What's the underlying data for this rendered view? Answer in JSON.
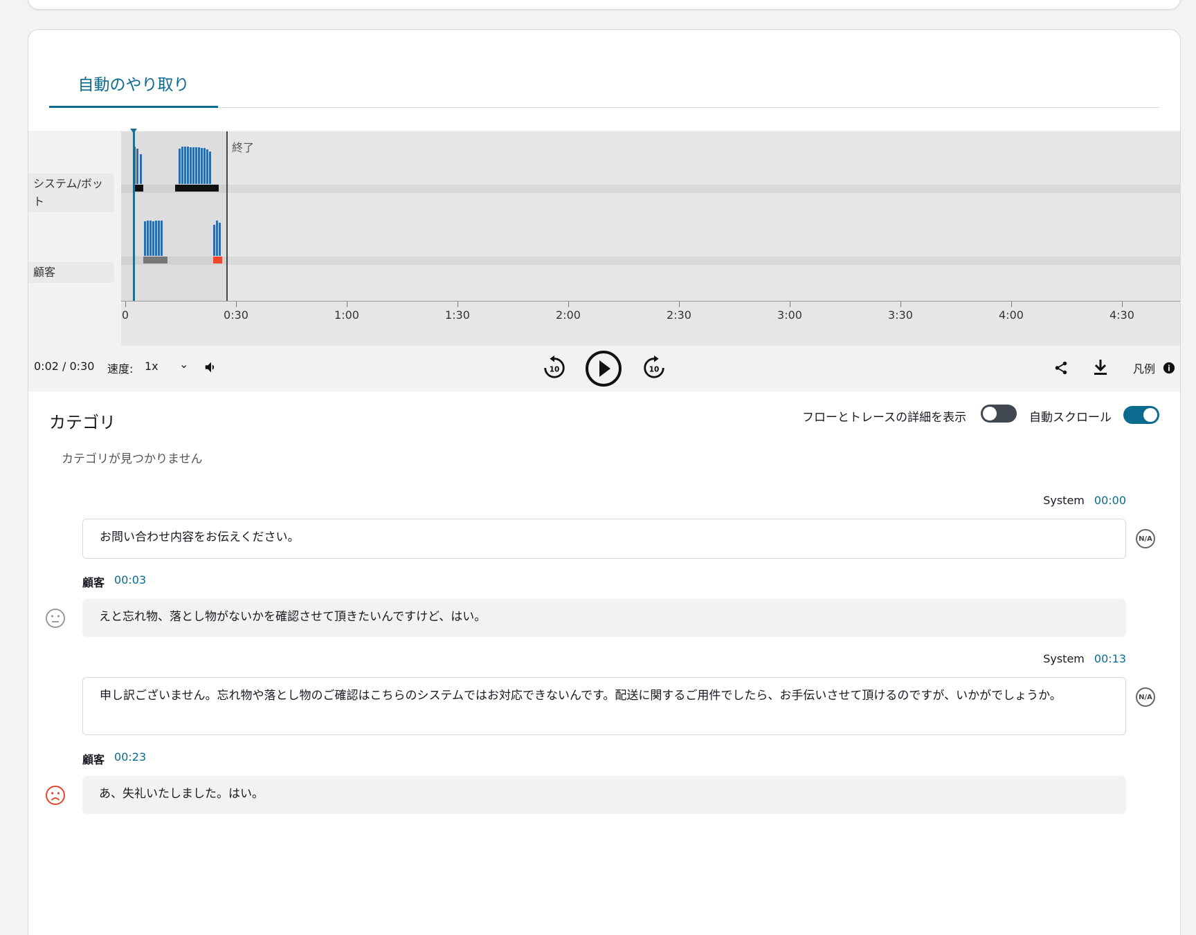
{
  "tab": {
    "label": "自動のやり取り"
  },
  "timeline": {
    "tracks": [
      {
        "label": "システム/ボット"
      },
      {
        "label": "顧客"
      }
    ],
    "end_label": "終了",
    "ticks": [
      "0",
      "0:30",
      "1:00",
      "1:30",
      "2:00",
      "2:30",
      "3:00",
      "3:30",
      "4:00",
      "4:30"
    ]
  },
  "controls": {
    "time": "0:02 / 0:30",
    "speed_label": "速度:",
    "speed_value": "1x",
    "legend_label": "凡例"
  },
  "toggles": {
    "flow_label": "フローとトレースの詳細を表示",
    "flow_on": false,
    "autoscroll_label": "自動スクロール",
    "autoscroll_on": true,
    "accent_color": "#0b6b8f"
  },
  "categories": {
    "title": "カテゴリ",
    "empty": "カテゴリが見つかりません"
  },
  "transcript": [
    {
      "speaker": "System",
      "time": "00:00",
      "text": "お問い合わせ内容をお伝えください。",
      "sentiment": "N/A"
    },
    {
      "speaker": "顧客",
      "time": "00:03",
      "text": "えと忘れ物、落とし物がないかを確認させて頂きたいんですけど、はい。",
      "sentiment": "neutral"
    },
    {
      "speaker": "System",
      "time": "00:13",
      "text": "申し訳ございません。忘れ物や落とし物のご確認はこちらのシステムではお対応できないんです。配送に関するご用件でしたら、お手伝いさせて頂けるのですが、いかがでしょうか。",
      "sentiment": "N/A"
    },
    {
      "speaker": "顧客",
      "time": "00:23",
      "text": "あ、失礼いたしました。はい。",
      "sentiment": "negative"
    }
  ]
}
